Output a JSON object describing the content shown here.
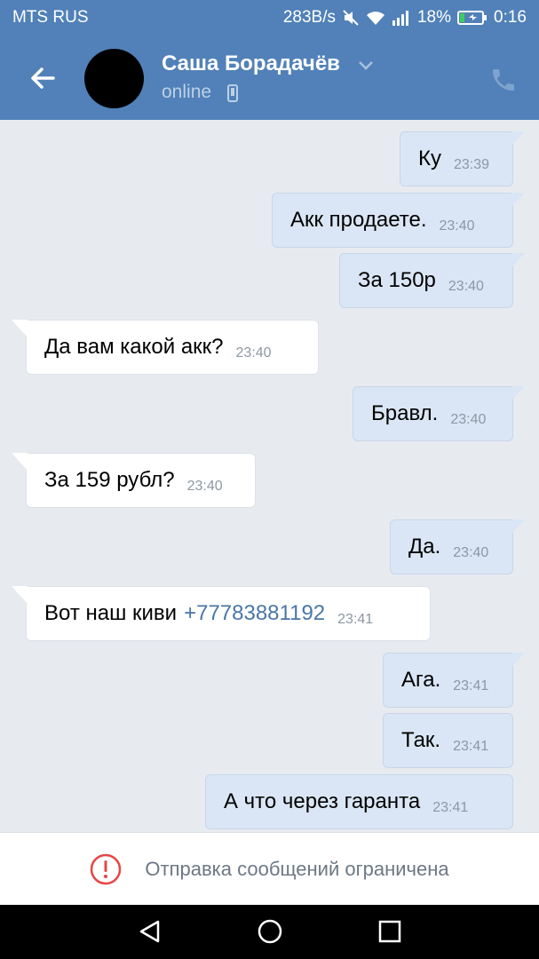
{
  "status_bar": {
    "carrier": "MTS RUS",
    "network_speed": "283B/s",
    "battery": "18%",
    "time": "0:16"
  },
  "header": {
    "contact_name": "Саша Борадачёв",
    "status": "online"
  },
  "messages": [
    {
      "direction": "out",
      "text": "Ку",
      "time": "23:39"
    },
    {
      "direction": "out",
      "text": "Акк продаете.",
      "time": "23:40"
    },
    {
      "direction": "out",
      "text": "За 150р",
      "time": "23:40"
    },
    {
      "direction": "in",
      "text": "Да вам какой акк?",
      "time": "23:40"
    },
    {
      "direction": "out",
      "text": "Бравл.",
      "time": "23:40"
    },
    {
      "direction": "in",
      "text": "За 159 рубл?",
      "time": "23:40"
    },
    {
      "direction": "out",
      "text": "Да.",
      "time": "23:40"
    },
    {
      "direction": "in",
      "text": "Вот наш киви",
      "link": "+77783881192",
      "time": "23:41"
    },
    {
      "direction": "out",
      "text": "Ага.",
      "time": "23:41"
    },
    {
      "direction": "out",
      "text": "Так.",
      "time": "23:41"
    },
    {
      "direction": "out",
      "text": "А что через гаранта",
      "time": "23:41"
    }
  ],
  "composer": {
    "restriction_text": "Отправка сообщений ограничена"
  },
  "colors": {
    "header": "#5181b8",
    "outgoing_bubble": "#dae6f5",
    "incoming_bubble": "#ffffff",
    "link": "#4a76a8",
    "warning": "#e64646"
  },
  "icons": {
    "back": "arrow-left-icon",
    "chevron": "chevron-down-icon",
    "call": "phone-icon",
    "warning": "exclamation-circle-icon",
    "nav": [
      "back-triangle-icon",
      "home-circle-icon",
      "recents-square-icon"
    ]
  }
}
